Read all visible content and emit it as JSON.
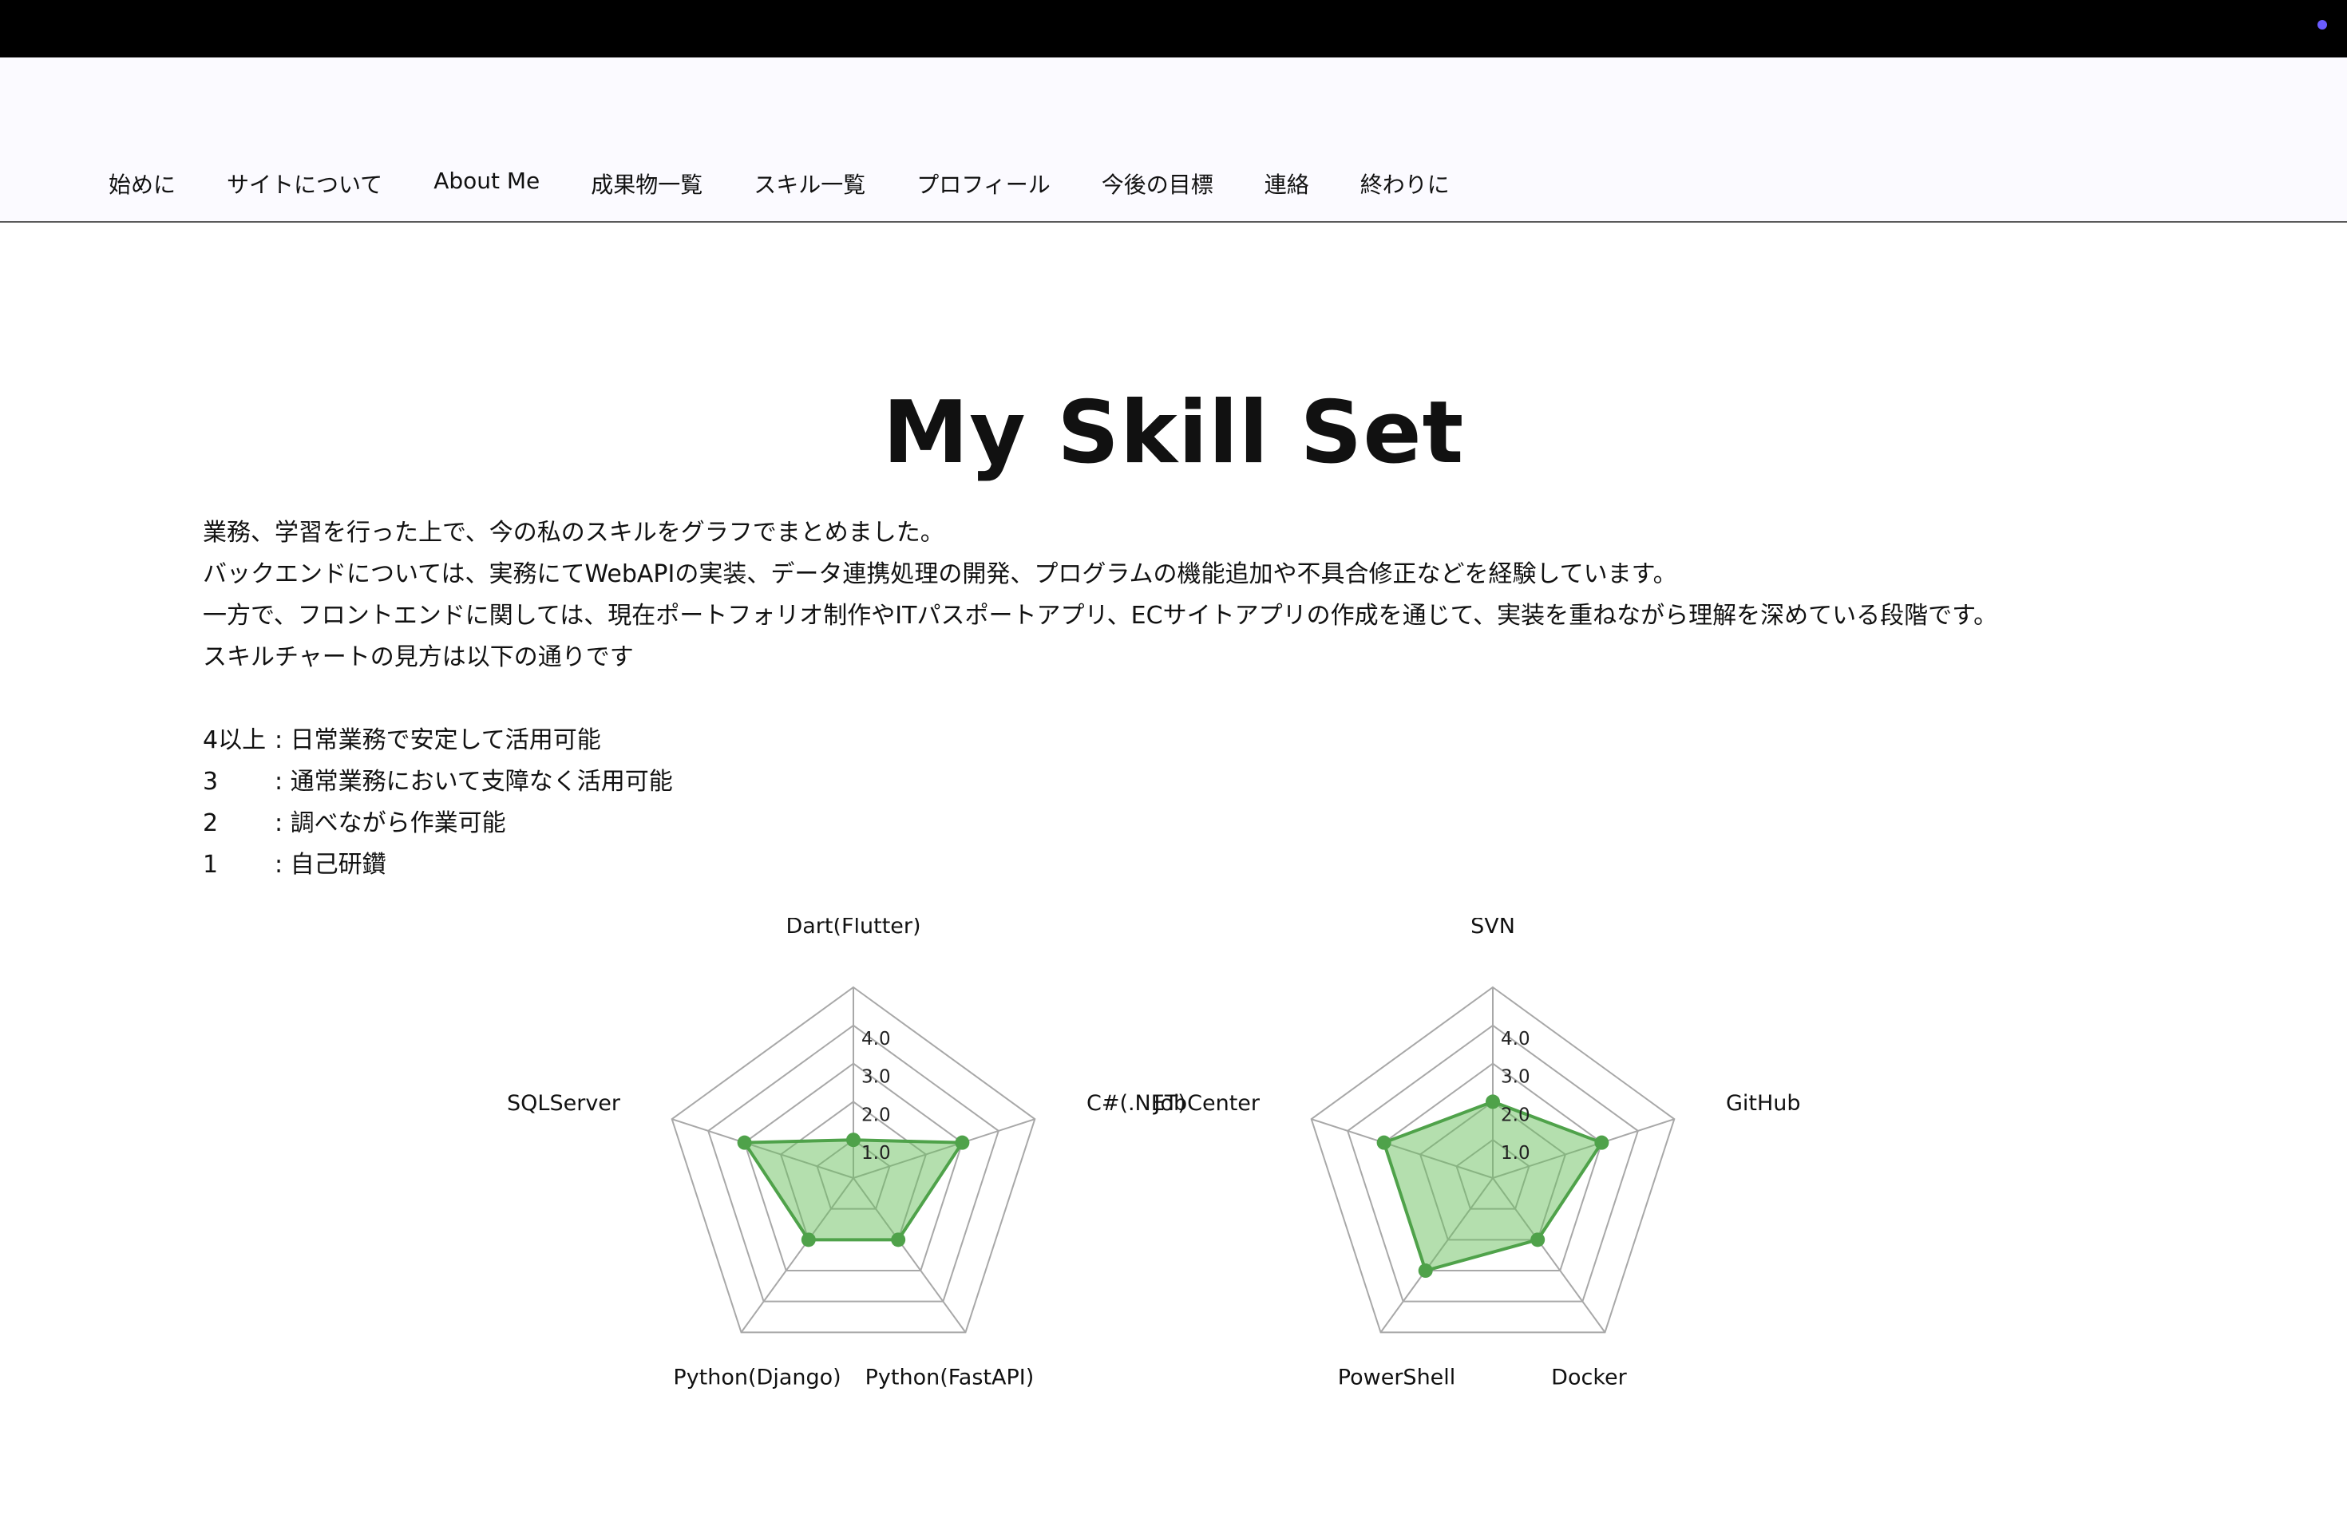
{
  "nav": {
    "items": [
      "始めに",
      "サイトについて",
      "About Me",
      "成果物一覧",
      "スキル一覧",
      "プロフィール",
      "今後の目標",
      "連絡",
      "終わりに"
    ]
  },
  "main": {
    "title": "My Skill Set",
    "paragraphs": [
      "業務、学習を行った上で、今の私のスキルをグラフでまとめました。",
      "バックエンドについては、実務にてWebAPIの実装、データ連携処理の開発、プログラムの機能追加や不具合修正などを経験しています。",
      "一方で、フロントエンドに関しては、現在ポートフォリオ制作やITパスポートアプリ、ECサイトアプリの作成を通じて、実装を重ねながら理解を深めている段階です。",
      "スキルチャートの見方は以下の通りです"
    ],
    "legend": [
      {
        "level": "4以上",
        "desc": ": 日常業務で安定して活用可能"
      },
      {
        "level": "3",
        "desc": ": 通常業務において支障なく活用可能"
      },
      {
        "level": "2",
        "desc": ": 調べながら作業可能"
      },
      {
        "level": "1",
        "desc": ": 自己研鑽"
      }
    ]
  },
  "colors": {
    "fill": "#6abf5e",
    "stroke": "#4fa24a",
    "grid": "#a8a8a8",
    "accent_dot": "#6a5cff"
  },
  "chart_data": [
    {
      "type": "radar",
      "axes": [
        "Dart(Flutter)",
        "C#(.NET)",
        "Python(FastAPI)",
        "Python(Django)",
        "SQLServer"
      ],
      "values": [
        1,
        3,
        2,
        2,
        3
      ],
      "ticks": [
        "1.0",
        "2.0",
        "3.0",
        "4.0"
      ],
      "rmax": 5
    },
    {
      "type": "radar",
      "axes": [
        "SVN",
        "GitHub",
        "Docker",
        "PowerShell",
        "JobCenter"
      ],
      "values": [
        2,
        3,
        2,
        3,
        3
      ],
      "ticks": [
        "1.0",
        "2.0",
        "3.0",
        "4.0"
      ],
      "rmax": 5
    }
  ]
}
